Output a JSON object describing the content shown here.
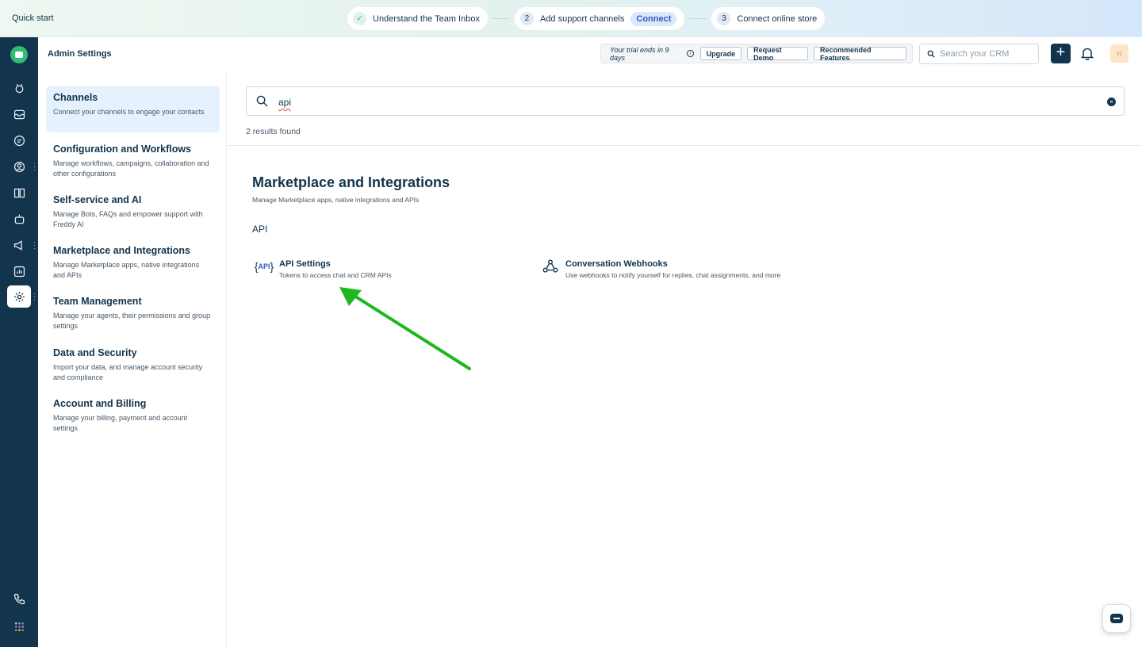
{
  "quick_start": {
    "title": "Quick start",
    "steps": [
      {
        "num": "✓",
        "label": "Understand the Team Inbox"
      },
      {
        "num": "2",
        "label": "Add support channels",
        "action": "Connect"
      },
      {
        "num": "3",
        "label": "Connect online store"
      }
    ]
  },
  "header": {
    "title": "Admin Settings",
    "trial_text": "Your trial ends in 9 days",
    "upgrade": "Upgrade",
    "request_demo": "Request Demo",
    "recommended": "Recommended Features",
    "search_placeholder": "Search your CRM",
    "avatar_initial": "H"
  },
  "nav": [
    {
      "title": "Channels",
      "desc": "Connect your channels to engage your contacts"
    },
    {
      "title": "Configuration and Workflows",
      "desc": "Manage workflows, campaigns, collaboration and other configurations"
    },
    {
      "title": "Self-service and AI",
      "desc": "Manage Bots, FAQs and empower support with Freddy AI"
    },
    {
      "title": "Marketplace and Integrations",
      "desc": "Manage Marketplace apps, native integrations and APIs"
    },
    {
      "title": "Team Management",
      "desc": "Manage your agents, their permissions and group settings"
    },
    {
      "title": "Data and Security",
      "desc": "Import your data, and manage account security and compliance"
    },
    {
      "title": "Account and Billing",
      "desc": "Manage your billing, payment and account settings"
    }
  ],
  "main": {
    "search_value": "api",
    "results": "2 results found",
    "section_title": "Marketplace and Integrations",
    "section_desc": "Manage Marketplace apps, native integrations and APIs",
    "group_title": "API",
    "items": [
      {
        "title": "API Settings",
        "desc": "Tokens to access chat and CRM APIs",
        "icon": "api-icon"
      },
      {
        "title": "Conversation Webhooks",
        "desc": "Use webhooks to notify yourself for replies, chat assignments, and more",
        "icon": "webhook-icon"
      }
    ]
  },
  "colors": {
    "rail": "#12344d",
    "accent": "#2c5cc5",
    "active_nav": "#e5f2fd",
    "arrow": "#1db81d"
  }
}
